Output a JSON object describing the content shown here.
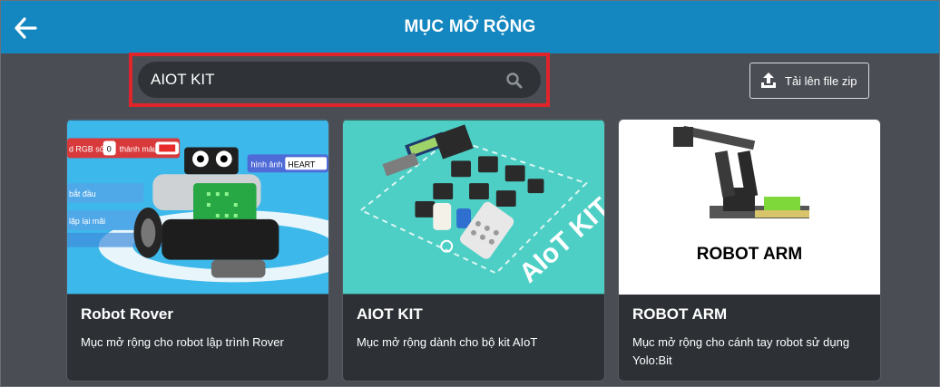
{
  "header": {
    "title": "MỤC MỞ RỘNG",
    "back_icon": "arrow-left-icon"
  },
  "search": {
    "value": "AIOT KIT",
    "icon": "search-icon",
    "highlight_color": "#e0242b"
  },
  "upload": {
    "label": "Tải lên file zip",
    "icon": "upload-icon"
  },
  "colors": {
    "header_bg": "#1486c0",
    "page_bg": "#4a4e54",
    "card_bg": "#2d3136"
  },
  "cards": [
    {
      "title": "Robot Rover",
      "description": "Mục mở rộng cho robot lập trình Rover",
      "image_texts": [
        "d RGB số",
        "0",
        "thành màu",
        "hình ảnh",
        "HEART",
        "bắt đầu",
        "lặp lại mãi"
      ]
    },
    {
      "title": "AIOT KIT",
      "description": "Mục mở rộng dành cho bộ kit AIoT",
      "image_text": "AIoT KIT"
    },
    {
      "title": "ROBOT ARM",
      "description": "Mục mở rộng cho cánh tay robot sử dụng Yolo:Bit",
      "image_text": "ROBOT ARM"
    }
  ]
}
